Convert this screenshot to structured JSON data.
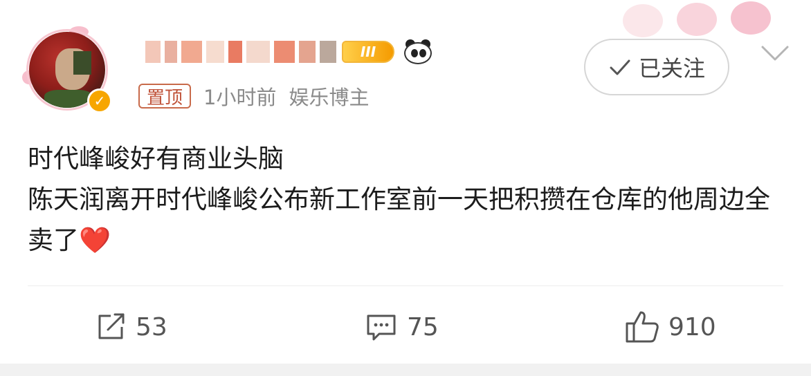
{
  "post": {
    "pin_label": "置顶",
    "time": "1小时前",
    "user_tag": "娱乐博主",
    "level_badge": "III",
    "follow_label": "已关注",
    "content_line1": "时代峰峻好有商业头脑",
    "content_line2": "陈天润离开时代峰峻公布新工作室前一天把积攒在仓库的他周边全卖了",
    "content_emoji": "❤️"
  },
  "actions": {
    "repost_count": "53",
    "comment_count": "75",
    "like_count": "910"
  },
  "icons": [
    "verified-v-icon",
    "panda-icon",
    "check-icon",
    "chevron-down-icon",
    "repost-icon",
    "comment-icon",
    "like-icon"
  ],
  "colors": {
    "pin_border": "#c86a4a",
    "verify_badge": "#f7a600",
    "level_badge": "#f59b00",
    "meta_gray": "#8a8a8a",
    "heart": "#e0202a"
  }
}
